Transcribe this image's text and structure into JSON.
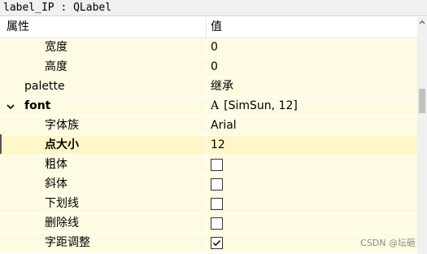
{
  "window": {
    "title": "label_IP : QLabel"
  },
  "header": {
    "property": "属性",
    "value": "值"
  },
  "rows": [
    {
      "name": "宽度",
      "value": "0",
      "kind": "text"
    },
    {
      "name": "高度",
      "value": "0",
      "kind": "text"
    },
    {
      "name": "palette",
      "value": "继承",
      "kind": "text"
    },
    {
      "name": "font",
      "value": "[SimSun, 12]",
      "kind": "font",
      "expander": "expanded"
    },
    {
      "name": "字体族",
      "value": "Arial",
      "kind": "text"
    },
    {
      "name": "点大小",
      "value": "12",
      "kind": "text"
    },
    {
      "name": "粗体",
      "checked": false,
      "kind": "checkbox"
    },
    {
      "name": "斜体",
      "checked": false,
      "kind": "checkbox"
    },
    {
      "name": "下划线",
      "checked": false,
      "kind": "checkbox"
    },
    {
      "name": "删除线",
      "checked": false,
      "kind": "checkbox"
    },
    {
      "name": "字距调整",
      "checked": true,
      "kind": "checkbox"
    }
  ],
  "font_glyph": "A",
  "watermark": "CSDN @坛砸",
  "colors": {
    "row_bg": "#fffbe3",
    "header_bg": "#ffffff",
    "titlebar_bg": "#f0f0f0"
  }
}
